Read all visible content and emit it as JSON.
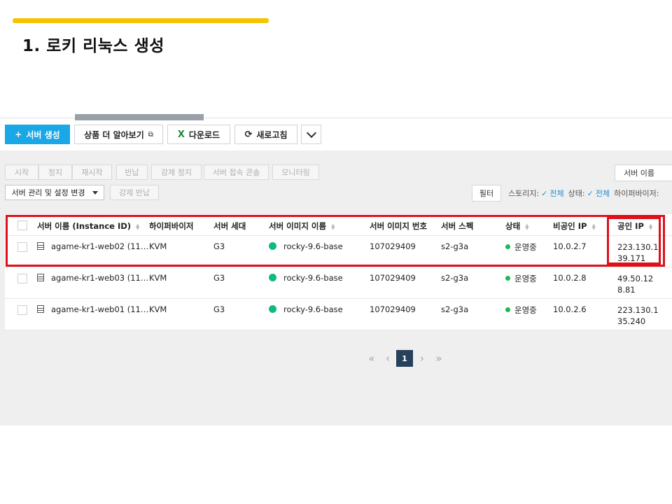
{
  "slide": {
    "title": "1. 로키 리눅스 생성"
  },
  "toolbar": {
    "create_label": "서버 생성",
    "create_icon": "+",
    "learn_more_label": "상품 더 알아보기",
    "learn_more_icon": "⧉",
    "download_label": "다운로드",
    "download_icon": "X",
    "refresh_label": "새로고침",
    "refresh_icon": "⟳"
  },
  "actions": {
    "row1": [
      "시작",
      "정지",
      "재시작",
      "반납",
      "강제 정지",
      "서버 접속 콘솔",
      "모니터링"
    ],
    "manage_label": "서버 관리 및 설정 변경",
    "force_return_label": "강제 반납"
  },
  "search": {
    "field_label": "서버 이름"
  },
  "filter": {
    "button_label": "필터",
    "storage_label": "스토리지:",
    "storage_value": "전체",
    "status_label": "상태:",
    "status_value": "전체",
    "hypervisor_label": "하이퍼바이저:"
  },
  "table": {
    "columns": [
      "서버 이름 (Instance ID)",
      "하이퍼바이저",
      "서버 세대",
      "서버 이미지 이름",
      "서버 이미지 번호",
      "서버 스펙",
      "상태",
      "비공인 IP",
      "공인 IP"
    ],
    "rows": [
      {
        "name": "agame-kr1-web02 (11…",
        "hypervisor": "KVM",
        "generation": "G3",
        "image_name": "rocky-9.6-base",
        "image_no": "107029409",
        "spec": "s2-g3a",
        "status": "운영중",
        "private_ip": "10.0.2.7",
        "public_ip": "223.130.139.171"
      },
      {
        "name": "agame-kr1-web03 (11…",
        "hypervisor": "KVM",
        "generation": "G3",
        "image_name": "rocky-9.6-base",
        "image_no": "107029409",
        "spec": "s2-g3a",
        "status": "운영중",
        "private_ip": "10.0.2.8",
        "public_ip": "49.50.128.81"
      },
      {
        "name": "agame-kr1-web01 (11…",
        "hypervisor": "KVM",
        "generation": "G3",
        "image_name": "rocky-9.6-base",
        "image_no": "107029409",
        "spec": "s2-g3a",
        "status": "운영중",
        "private_ip": "10.0.2.6",
        "public_ip": "223.130.135.240"
      }
    ]
  },
  "pagination": {
    "first": "«",
    "prev": "‹",
    "current": "1",
    "next": "›",
    "last": "»"
  },
  "colors": {
    "accent": "#1aa7e6",
    "highlight": "#e0101a",
    "title_bar": "#f5c400",
    "status_running": "#1db954"
  }
}
